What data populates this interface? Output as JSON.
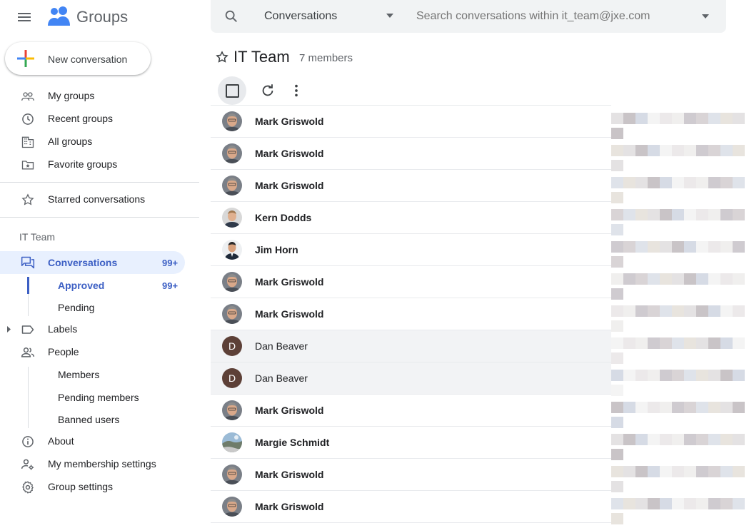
{
  "app": {
    "name": "Groups"
  },
  "search": {
    "scope": "Conversations",
    "placeholder": "Search conversations within it_team@jxe.com"
  },
  "sidebar": {
    "new_button": "New conversation",
    "items": [
      {
        "label": "My groups"
      },
      {
        "label": "Recent groups"
      },
      {
        "label": "All groups"
      },
      {
        "label": "Favorite groups"
      },
      {
        "label": "Starred conversations"
      }
    ],
    "group_header": "IT Team",
    "conversations": {
      "label": "Conversations",
      "count": "99+"
    },
    "approved": {
      "label": "Approved",
      "count": "99+"
    },
    "pending": {
      "label": "Pending"
    },
    "labels": {
      "label": "Labels"
    },
    "people": {
      "label": "People"
    },
    "members": {
      "label": "Members"
    },
    "pending_members": {
      "label": "Pending members"
    },
    "banned_users": {
      "label": "Banned users"
    },
    "about": {
      "label": "About"
    },
    "membership_settings": {
      "label": "My membership settings"
    },
    "group_settings": {
      "label": "Group settings"
    }
  },
  "main": {
    "title": "IT Team",
    "members": "7 members",
    "rows": [
      {
        "name": "Mark Griswold",
        "avatar": "mark"
      },
      {
        "name": "Mark Griswold",
        "avatar": "mark"
      },
      {
        "name": "Mark Griswold",
        "avatar": "mark"
      },
      {
        "name": "Kern Dodds",
        "avatar": "kern"
      },
      {
        "name": "Jim Horn",
        "avatar": "jim"
      },
      {
        "name": "Mark Griswold",
        "avatar": "mark"
      },
      {
        "name": "Mark Griswold",
        "avatar": "mark"
      },
      {
        "name": "Dan Beaver",
        "avatar": "D",
        "read": true
      },
      {
        "name": "Dan Beaver",
        "avatar": "D",
        "read": true
      },
      {
        "name": "Mark Griswold",
        "avatar": "mark"
      },
      {
        "name": "Margie Schmidt",
        "avatar": "margie"
      },
      {
        "name": "Mark Griswold",
        "avatar": "mark"
      },
      {
        "name": "Mark Griswold",
        "avatar": "mark"
      }
    ]
  },
  "colors": {
    "accent": "#3c5fc4",
    "selected_bg": "#e8f0fe",
    "avatar_d": "#5d4037"
  }
}
